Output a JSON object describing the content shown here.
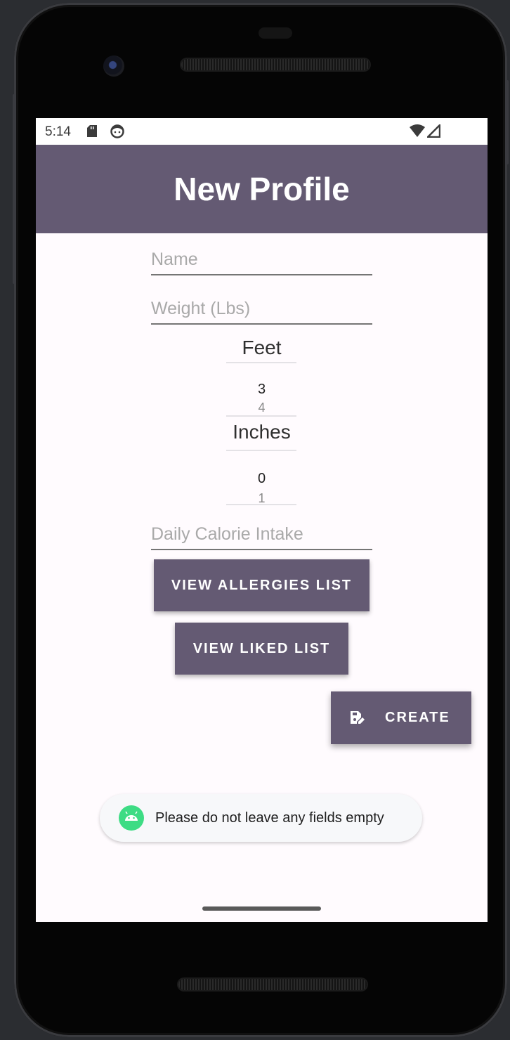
{
  "status_bar": {
    "time": "5:14"
  },
  "app_bar": {
    "title": "New Profile"
  },
  "form": {
    "name_placeholder": "Name",
    "weight_placeholder": "Weight (Lbs)",
    "feet_label": "Feet",
    "feet_values": [
      "3",
      "4"
    ],
    "inches_label": "Inches",
    "inches_values": [
      "0",
      "1"
    ],
    "calories_placeholder": "Daily Calorie Intake"
  },
  "buttons": {
    "allergies": "VIEW ALLERGIES LIST",
    "liked": "VIEW LIKED LIST",
    "create": "CREATE"
  },
  "toast": {
    "message": "Please do not leave any fields empty"
  },
  "colors": {
    "primary": "#645a73",
    "background": "#fffbfe",
    "android_green": "#3ddc84"
  }
}
